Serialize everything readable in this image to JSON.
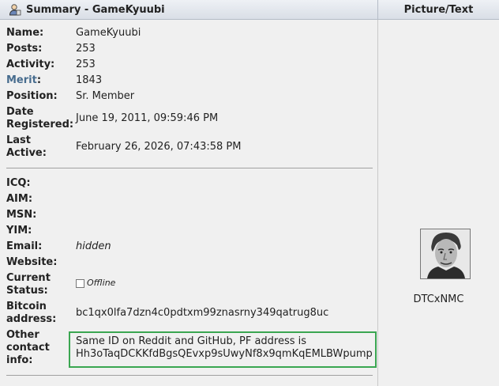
{
  "header": {
    "title": "Summary - GameKyuubi",
    "right_title": "Picture/Text"
  },
  "profile": {
    "name_label": "Name:",
    "name": "GameKyuubi",
    "posts_label": "Posts:",
    "posts": "253",
    "activity_label": "Activity:",
    "activity": "253",
    "merit_label": "Merit",
    "merit_colon": ":",
    "merit": "1843",
    "position_label": "Position:",
    "position": "Sr. Member",
    "date_label_1": "Date",
    "date_label_2": "Registered:",
    "date_registered": "June 19, 2011, 09:59:46 PM",
    "last_label_1": "Last",
    "last_label_2": "Active:",
    "last_active": "February 26, 2026, 07:43:58 PM"
  },
  "contact": {
    "icq_label": "ICQ:",
    "aim_label": "AIM:",
    "msn_label": "MSN:",
    "yim_label": "YIM:",
    "email_label": "Email:",
    "email": "hidden",
    "website_label": "Website:",
    "status_label_1": "Current",
    "status_label_2": "Status:",
    "status": "Offline",
    "btc_label_1": "Bitcoin",
    "btc_label_2": "address:",
    "btc_address": "bc1qx0lfa7dzn4c0pdtxm99znasrny349qatrug8uc",
    "other_label_1": "Other",
    "other_label_2": "contact",
    "other_label_3": "info:",
    "other_line_1": "Same ID on Reddit and GitHub, PF address is",
    "other_line_2": "Hh3oTaqDCKKfdBgsQEvxp9sUwyNf8x9qmKqEMLBWpump"
  },
  "picture": {
    "username": "DTCxNMC"
  },
  "colors": {
    "highlight_border": "#3aa651",
    "merit_label": "#476c8e"
  }
}
